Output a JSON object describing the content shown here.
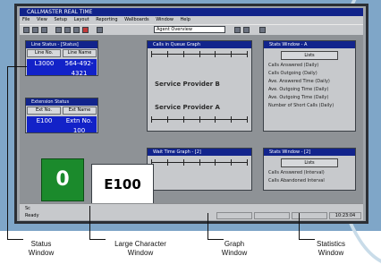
{
  "app": {
    "title": "CALLMASTER REAL TIME",
    "menu": [
      "File",
      "View",
      "Setup",
      "Layout",
      "Reporting",
      "Wallboards",
      "Window",
      "Help"
    ],
    "toolbar_combo": "Agent Overview"
  },
  "status_window": {
    "title": "Line Status - [Status]",
    "columns": [
      "Line No.",
      "Line Name"
    ],
    "row": {
      "line_no": "L3000",
      "line_name": "564-492-4321"
    }
  },
  "extension_window": {
    "title": "Extension Status",
    "columns": [
      "Ext No.",
      "Ext Name"
    ],
    "row": {
      "ext_no": "E100",
      "ext_name": "Extn No. 100"
    }
  },
  "graph_window_top": {
    "title": "Calls in Queue Graph",
    "scale_top": [
      "0",
      "1",
      "2",
      "3",
      "4",
      "5",
      "6"
    ],
    "scale_bottom": [
      "0",
      "1",
      "2",
      "3",
      "4",
      "5",
      "6"
    ],
    "labels": [
      "Service Provider B",
      "Service Provider A"
    ]
  },
  "stats_window_top": {
    "title": "Stats Window - A",
    "button": "Lists",
    "lines": [
      "Calls Answered (Daily)",
      "Calls Outgoing (Daily)",
      "Ave. Answered Time (Daily)",
      "Ave. Outgoing Time (Daily)",
      "Ave. Outgoing Time (Daily)",
      "Number of Short Calls (Daily)"
    ]
  },
  "graph_window_bottom": {
    "title": "Wait Time Graph - [2]",
    "scale": [
      "0",
      "1",
      "2",
      "3",
      "4",
      "5",
      "6"
    ]
  },
  "stats_window_bottom": {
    "title": "Stats Window - [2]",
    "button": "Lists",
    "lines": [
      "Calls Answered (Interval)",
      "Calls Abandoned Interval"
    ]
  },
  "green_window": {
    "value": "0"
  },
  "large_character_window": {
    "value": "E100"
  },
  "statusbar": {
    "task": "Sc",
    "left": "Ready",
    "right": "10:23:04"
  },
  "callouts": [
    {
      "label": "Status\nWindow"
    },
    {
      "label": "Large Character\nWindow"
    },
    {
      "label": "Graph\nWindow"
    },
    {
      "label": "Statistics\nWindow"
    }
  ]
}
